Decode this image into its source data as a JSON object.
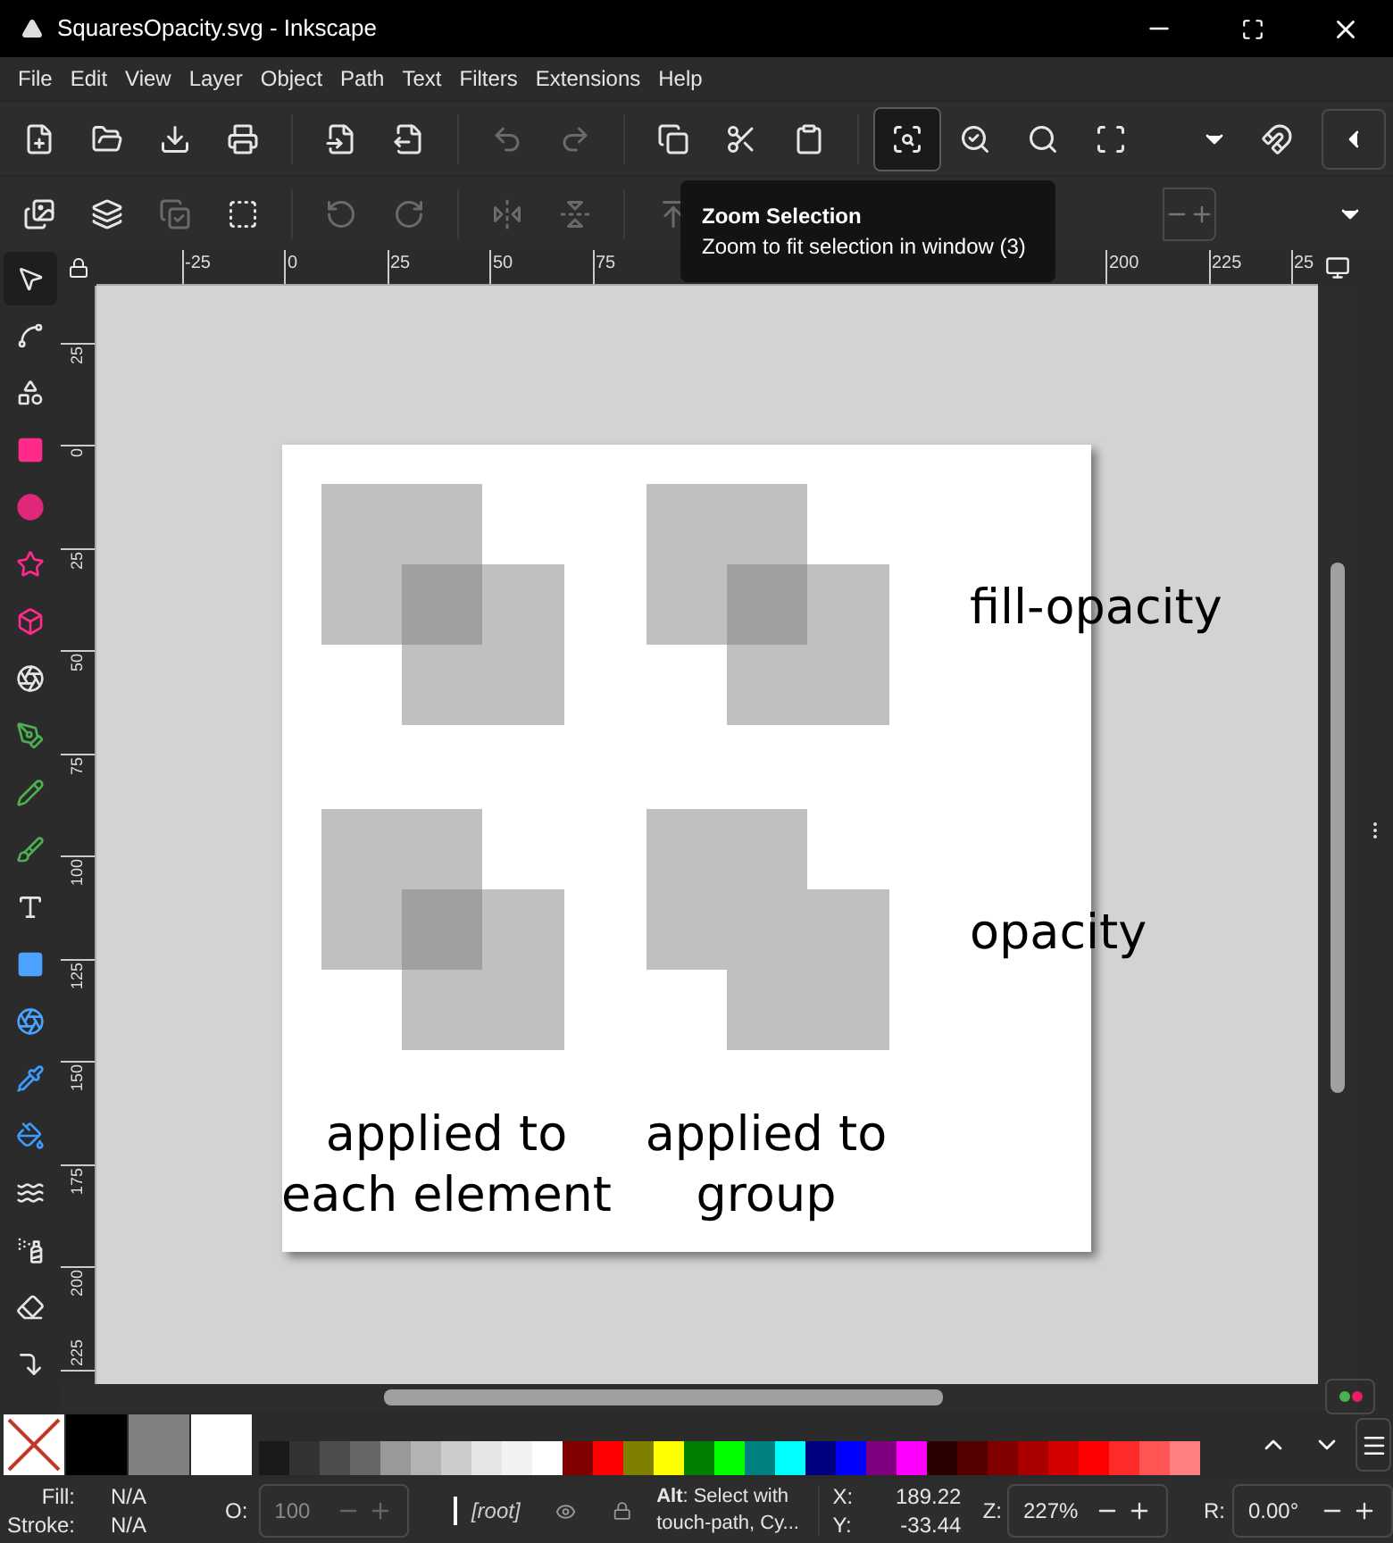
{
  "window": {
    "title": "SquaresOpacity.svg - Inkscape"
  },
  "menu": [
    "File",
    "Edit",
    "View",
    "Layer",
    "Object",
    "Path",
    "Text",
    "Filters",
    "Extensions",
    "Help"
  ],
  "toolbar": [
    {
      "disabled": false,
      "selected": false
    },
    {
      "disabled": false,
      "selected": false
    },
    {
      "disabled": false,
      "selected": false
    },
    {
      "disabled": false,
      "selected": false
    },
    {
      "disabled": false,
      "selected": false
    },
    {
      "disabled": false,
      "selected": false
    },
    {
      "disabled": true,
      "selected": false
    },
    {
      "disabled": true,
      "selected": false
    },
    {
      "disabled": false,
      "selected": false
    },
    {
      "disabled": false,
      "selected": false
    },
    {
      "disabled": false,
      "selected": false
    },
    {
      "disabled": false,
      "selected": true
    },
    {
      "disabled": false,
      "selected": false
    },
    {
      "disabled": false,
      "selected": false
    },
    {
      "disabled": false,
      "selected": false
    }
  ],
  "tool_controls": [
    {
      "disabled": false
    },
    {
      "disabled": false
    },
    {
      "disabled": true
    },
    {
      "disabled": false
    },
    {
      "disabled": true
    },
    {
      "disabled": true
    },
    {
      "disabled": true
    },
    {
      "disabled": true
    },
    {
      "disabled": true
    }
  ],
  "tooltip": {
    "title": "Zoom Selection",
    "text": "Zoom to fit selection in window (3)"
  },
  "ruler_h": [
    "-25",
    "0",
    "25",
    "50",
    "75",
    "200",
    "225",
    "25"
  ],
  "ruler_v": [
    "25",
    "0",
    "25",
    "50",
    "75",
    "100",
    "125",
    "150",
    "175",
    "200",
    "225"
  ],
  "tools": [
    {
      "selected": true
    },
    {
      "selected": false
    },
    {
      "selected": false
    },
    {
      "selected": false
    },
    {
      "selected": false
    },
    {
      "selected": false
    },
    {
      "selected": false
    },
    {
      "selected": false
    },
    {
      "selected": false
    },
    {
      "selected": false
    },
    {
      "selected": false
    },
    {
      "selected": false
    },
    {
      "selected": false
    },
    {
      "selected": false
    },
    {
      "selected": false
    },
    {
      "selected": false
    },
    {
      "selected": false
    },
    {
      "selected": false
    },
    {
      "selected": false
    },
    {
      "selected": false
    }
  ],
  "canvas": {
    "square_groups": [
      {
        "kind": "overlap"
      },
      {
        "kind": "overlap"
      },
      {
        "kind": "overlap"
      },
      {
        "kind": "merged"
      }
    ],
    "row_labels": [
      "fill-opacity",
      "opacity"
    ],
    "captions": [
      {
        "lines": [
          "applied to",
          "each element"
        ]
      },
      {
        "lines": [
          "applied to",
          "group"
        ]
      }
    ]
  },
  "palette": [
    {
      "kind": "none"
    },
    {
      "kind": "large",
      "color": "#000000"
    },
    {
      "kind": "large",
      "color": "#808080"
    },
    {
      "kind": "large",
      "color": "#ffffff"
    },
    {
      "kind": "small",
      "color": "#1a1a1a"
    },
    {
      "kind": "small",
      "color": "#333333"
    },
    {
      "kind": "small",
      "color": "#4d4d4d"
    },
    {
      "kind": "small",
      "color": "#666666"
    },
    {
      "kind": "small",
      "color": "#999999"
    },
    {
      "kind": "small",
      "color": "#b3b3b3"
    },
    {
      "kind": "small",
      "color": "#cccccc"
    },
    {
      "kind": "small",
      "color": "#e6e6e6"
    },
    {
      "kind": "small",
      "color": "#f2f2f2"
    },
    {
      "kind": "small",
      "color": "#ffffff"
    },
    {
      "kind": "small",
      "color": "#800000"
    },
    {
      "kind": "small",
      "color": "#ff0000"
    },
    {
      "kind": "small",
      "color": "#808000"
    },
    {
      "kind": "small",
      "color": "#ffff00"
    },
    {
      "kind": "small",
      "color": "#008000"
    },
    {
      "kind": "small",
      "color": "#00ff00"
    },
    {
      "kind": "small",
      "color": "#008080"
    },
    {
      "kind": "small",
      "color": "#00ffff"
    },
    {
      "kind": "small",
      "color": "#000080"
    },
    {
      "kind": "small",
      "color": "#0000ff"
    },
    {
      "kind": "small",
      "color": "#800080"
    },
    {
      "kind": "small",
      "color": "#ff00ff"
    },
    {
      "kind": "small",
      "color": "#2b0000"
    },
    {
      "kind": "small",
      "color": "#550000"
    },
    {
      "kind": "small",
      "color": "#800000"
    },
    {
      "kind": "small",
      "color": "#aa0000"
    },
    {
      "kind": "small",
      "color": "#d40000"
    },
    {
      "kind": "small",
      "color": "#ff0000"
    },
    {
      "kind": "small",
      "color": "#ff2a2a"
    },
    {
      "kind": "small",
      "color": "#ff5555"
    },
    {
      "kind": "small",
      "color": "#ff8080"
    }
  ],
  "status": {
    "fill_label": "Fill:",
    "fill_value": "N/A",
    "stroke_label": "Stroke:",
    "stroke_value": "N/A",
    "opacity_label": "O:",
    "opacity_value": "100",
    "layer": "[root]",
    "message": "**Alt**: Select with touch-path, Cy...",
    "x_label": "X:",
    "x_value": "189.22",
    "y_label": "Y:",
    "y_value": "-33.44",
    "zoom_label": "Z:",
    "zoom_value": "227%",
    "rotate_label": "R:",
    "rotate_value": "0.00°"
  }
}
